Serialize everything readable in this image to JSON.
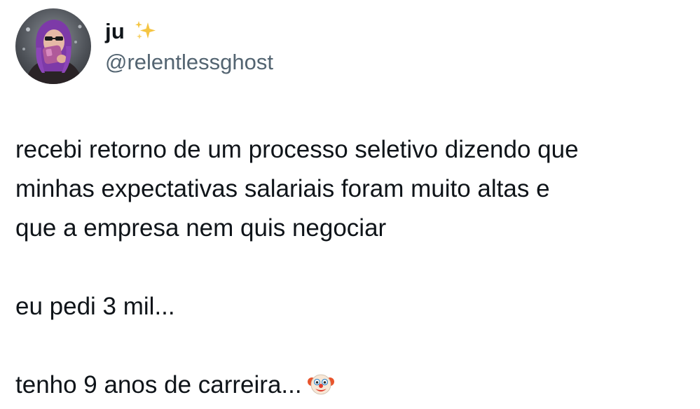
{
  "tweet": {
    "author": {
      "display_name": "ju",
      "display_name_emoji": "sparkles-icon",
      "handle": "@relentlessghost",
      "avatar": "avatar"
    },
    "body": {
      "line1": "recebi retorno de um processo seletivo dizendo que",
      "line2": "minhas expectativas salariais foram muito altas e",
      "line3": "que a empresa nem quis negociar",
      "line4": "eu pedi 3 mil...",
      "line5": "tenho 9 anos de carreira...",
      "trailing_emoji": "clown-face-icon"
    }
  },
  "colors": {
    "text": "#0f1419",
    "secondary_text": "#536471",
    "background": "#ffffff",
    "sparkle": "#f5c542"
  }
}
